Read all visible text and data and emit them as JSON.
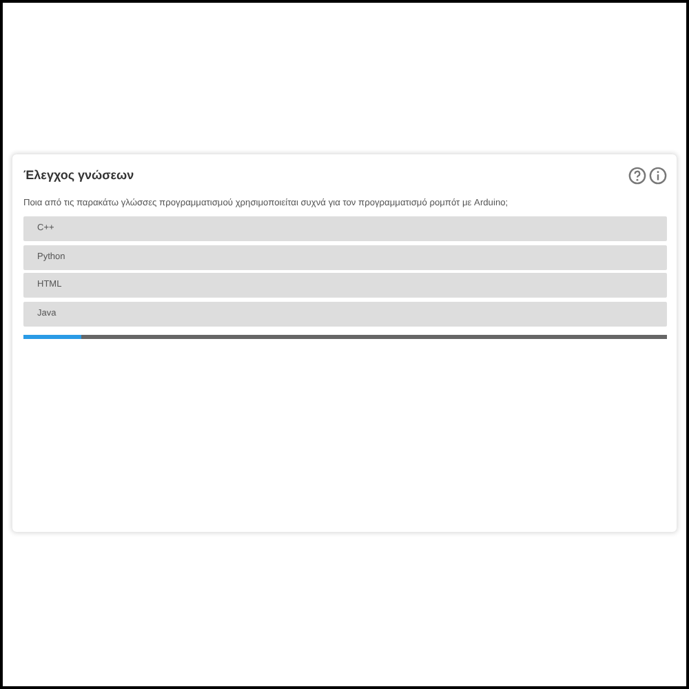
{
  "quiz": {
    "title": "Έλεγχος γνώσεων",
    "question": "Ποια από τις παρακάτω γλώσσες προγραμματισμού χρησιμοποιείται συχνά για τον προγραμματισμό ρομπότ με Arduino;",
    "options": [
      {
        "label": "C++"
      },
      {
        "label": "Python"
      },
      {
        "label": "HTML"
      },
      {
        "label": "Java"
      }
    ],
    "progress": {
      "level": 0.09
    }
  }
}
